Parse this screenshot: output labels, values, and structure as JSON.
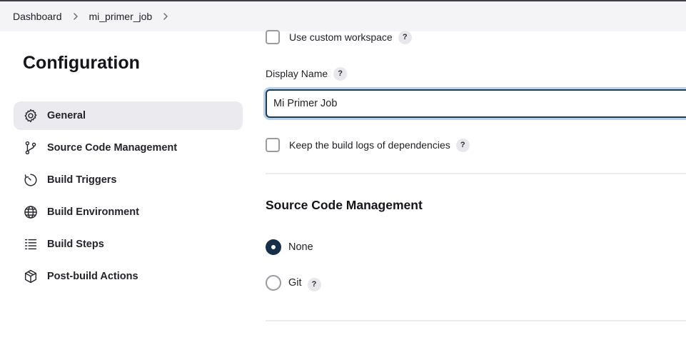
{
  "breadcrumb": {
    "items": [
      "Dashboard",
      "mi_primer_job"
    ]
  },
  "page": {
    "title": "Configuration"
  },
  "sidebar": {
    "items": [
      {
        "label": "General",
        "icon": "gear-icon",
        "active": true
      },
      {
        "label": "Source Code Management",
        "icon": "git-branch-icon"
      },
      {
        "label": "Build Triggers",
        "icon": "timer-icon"
      },
      {
        "label": "Build Environment",
        "icon": "globe-icon"
      },
      {
        "label": "Build Steps",
        "icon": "list-icon"
      },
      {
        "label": "Post-build Actions",
        "icon": "package-icon"
      }
    ]
  },
  "general": {
    "custom_workspace_label": "Use custom workspace",
    "display_name_label": "Display Name",
    "display_name_value": "Mi Primer Job",
    "keep_logs_label": "Keep the build logs of dependencies",
    "help_glyph": "?"
  },
  "scm": {
    "title": "Source Code Management",
    "options": [
      {
        "label": "None",
        "selected": true
      },
      {
        "label": "Git",
        "selected": false
      }
    ]
  },
  "colors": {
    "accent": "#17304a",
    "focus_ring": "#b9d1e8",
    "breadcrumb_bg": "#f4f4f6",
    "active_nav_bg": "#ebebef"
  }
}
